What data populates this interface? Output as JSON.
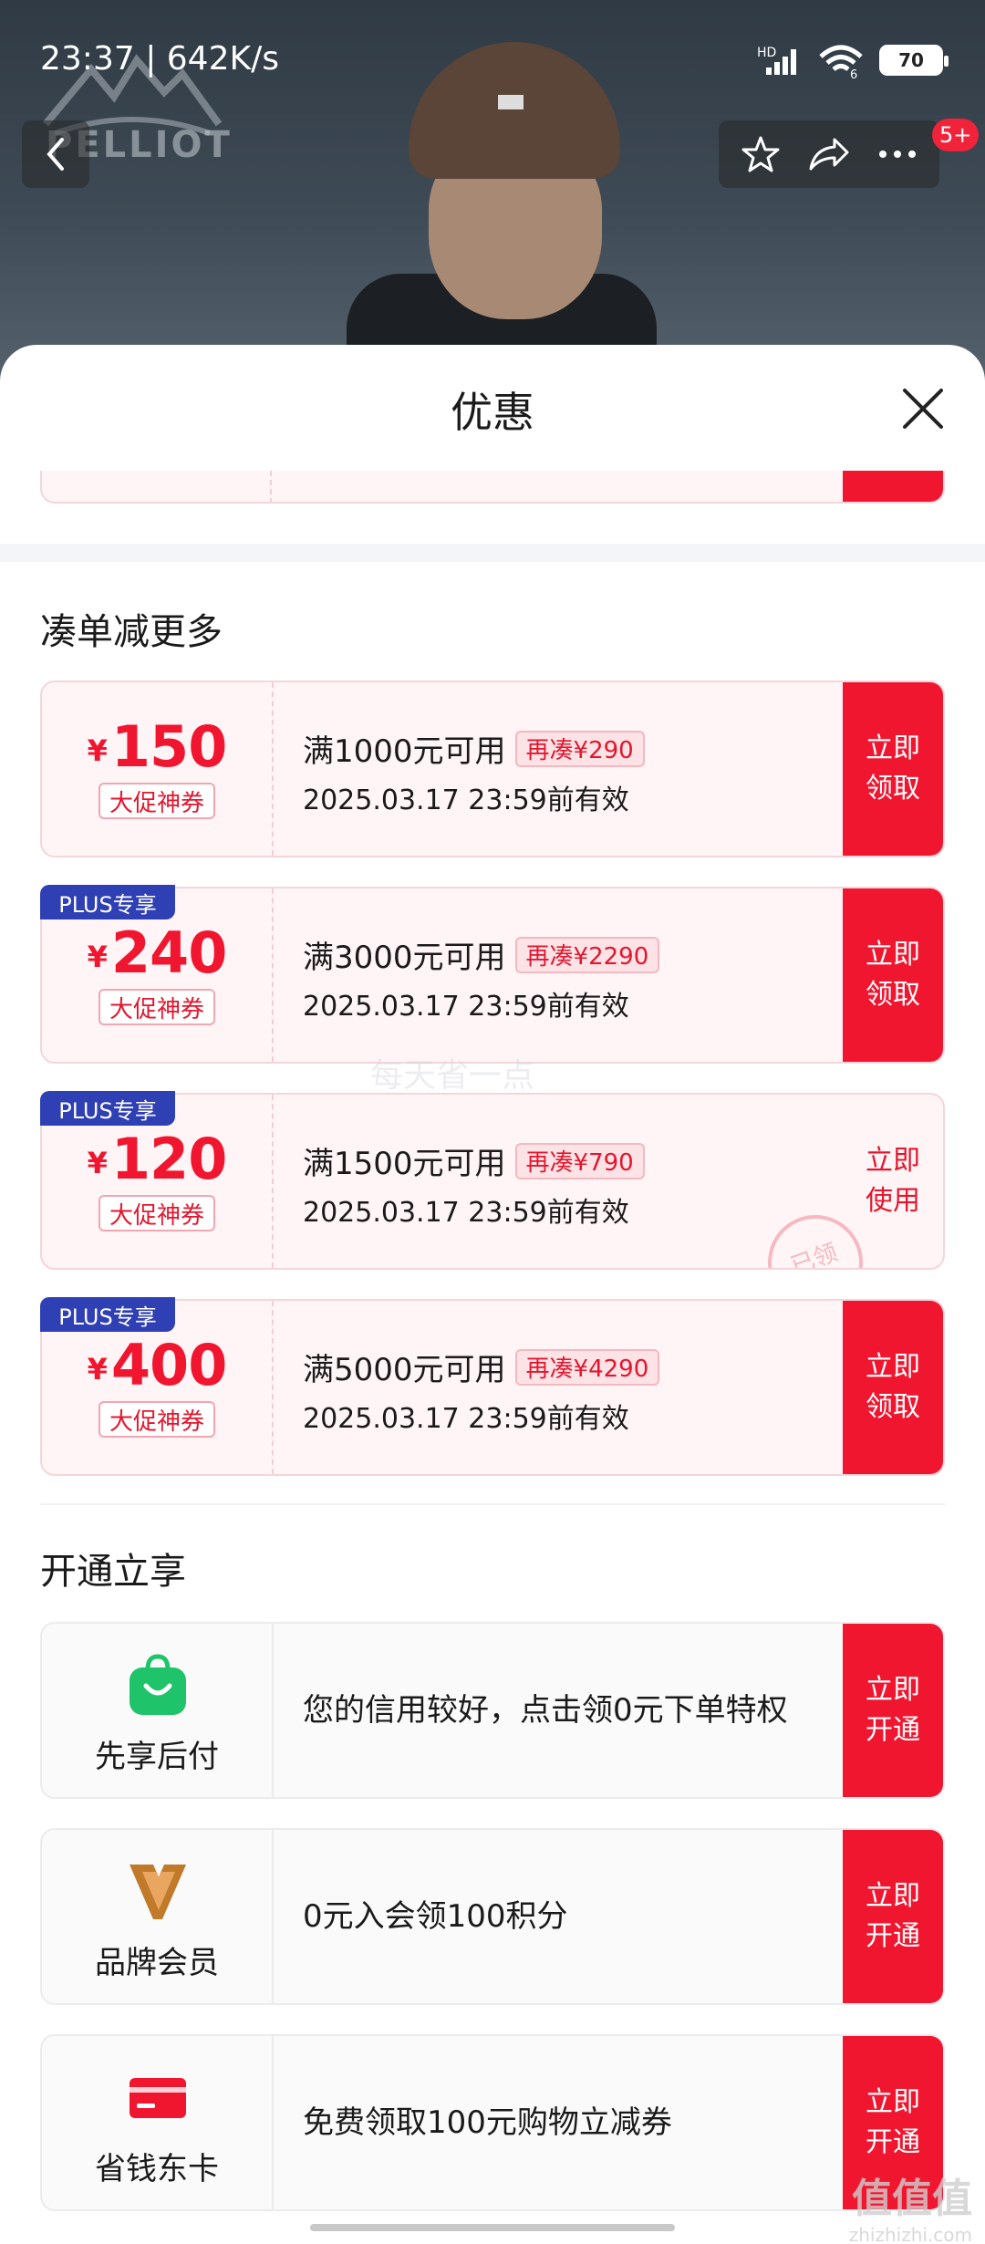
{
  "status_bar": {
    "time": "23:37 | 642K/s",
    "network": "HD",
    "wifi_label": "6",
    "battery": "70"
  },
  "header": {
    "brand_logo": "PELLIOT",
    "notification_count": "5+"
  },
  "sheet": {
    "title": "优惠"
  },
  "section_more": {
    "title": "凑单减更多"
  },
  "coupons": [
    {
      "currency": "¥",
      "amount": "150",
      "tag": "大促神券",
      "condition": "满1000元可用",
      "more": "再凑¥290",
      "valid": "2025.03.17 23:59前有效",
      "action": "立即领取",
      "plus": ""
    },
    {
      "currency": "¥",
      "amount": "240",
      "tag": "大促神券",
      "condition": "满3000元可用",
      "more": "再凑¥2290",
      "valid": "2025.03.17 23:59前有效",
      "action": "立即领取",
      "plus": "PLUS专享"
    },
    {
      "currency": "¥",
      "amount": "120",
      "tag": "大促神券",
      "condition": "满1500元可用",
      "more": "再凑¥790",
      "valid": "2025.03.17 23:59前有效",
      "action": "立即使用",
      "plus": "PLUS专享",
      "stamp": "已领"
    },
    {
      "currency": "¥",
      "amount": "400",
      "tag": "大促神券",
      "condition": "满5000元可用",
      "more": "再凑¥4290",
      "valid": "2025.03.17 23:59前有效",
      "action": "立即领取",
      "plus": "PLUS专享"
    }
  ],
  "watermark": "每天省一点",
  "section_open": {
    "title": "开通立享"
  },
  "services": [
    {
      "icon": "shopping-bag-icon",
      "label": "先享后付",
      "desc": "您的信用较好，点击领0元下单特权",
      "action": "立即开通"
    },
    {
      "icon": "brand-member-v-icon",
      "label": "品牌会员",
      "desc": "0元入会领100积分",
      "action": "立即开通"
    },
    {
      "icon": "red-card-icon",
      "label": "省钱东卡",
      "desc": "免费领取100元购物立减券",
      "action": "立即开通"
    }
  ],
  "site_mark": {
    "title": "值值值",
    "url": "zhizhizhi.com"
  },
  "colors": {
    "accent": "#f0162f",
    "plus": "#2f3fb4",
    "member_gold": "#c07a2a",
    "pay_green": "#1fc46a"
  }
}
